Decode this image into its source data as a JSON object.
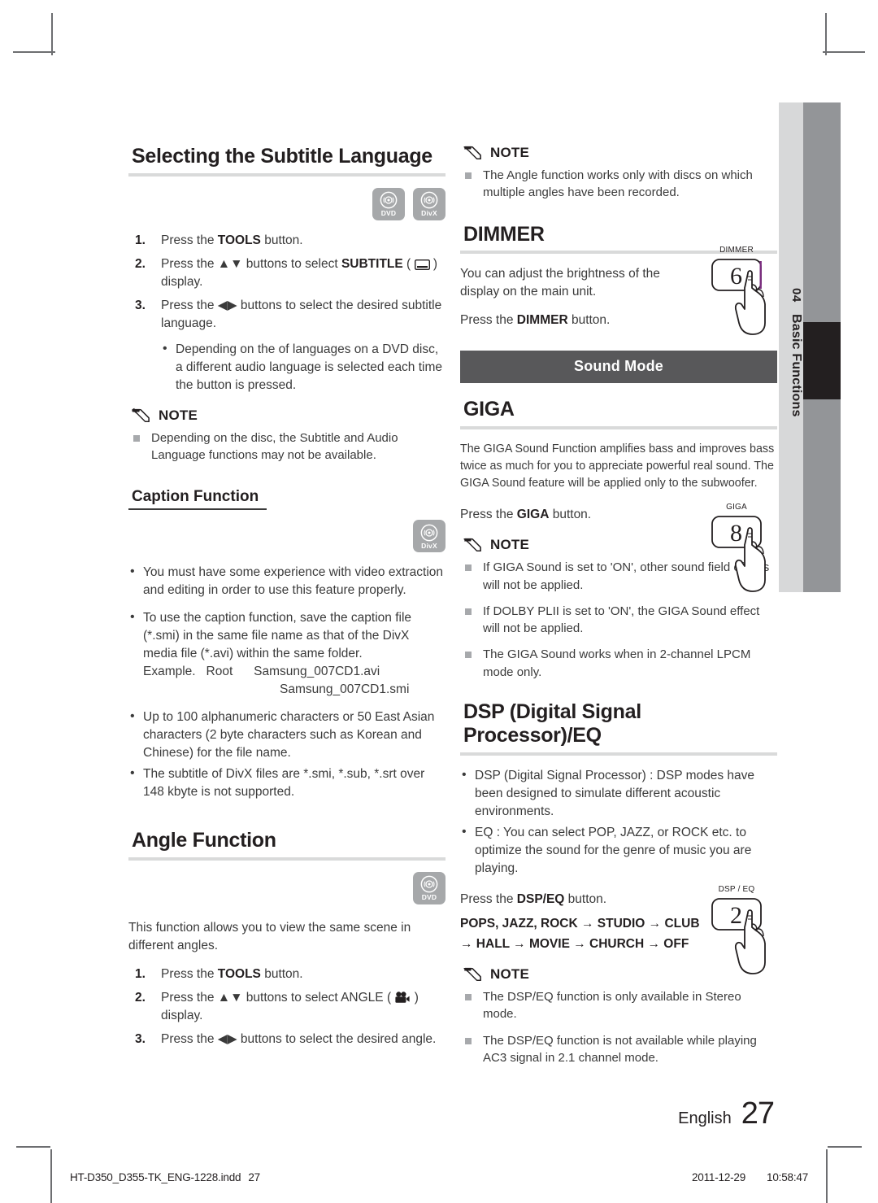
{
  "document": {
    "chapter_number": "04",
    "chapter_name": "Basic Functions",
    "page_language": "English",
    "page_number": "27",
    "imprint_file": "HT-D350_D355-TK_ENG-1228.indd",
    "imprint_page": "27",
    "imprint_date": "2011-12-29",
    "imprint_time": "10:58:47"
  },
  "left_column": {
    "subtitle_section": {
      "title": "Selecting the Subtitle Language",
      "badges": [
        {
          "label": "DVD",
          "icon": "disc-icon"
        },
        {
          "label": "DivX",
          "icon": "disc-icon"
        }
      ],
      "steps": [
        {
          "num": "1.",
          "pre": "Press the ",
          "bold": "TOOLS",
          "post": " button."
        },
        {
          "num": "2.",
          "pre": "Press the ▲▼ buttons to select ",
          "bold": "SUBTITLE",
          "post": " (  ) display."
        },
        {
          "num": "3.",
          "pre": "Press the ◀▶ buttons to select the desired subtitle language.",
          "bold": "",
          "post": ""
        }
      ],
      "sub_bullets": [
        "Depending on the of languages on a DVD disc, a different audio language is selected each time the button is pressed."
      ],
      "note_label": "NOTE",
      "notes": [
        "Depending on the disc, the Subtitle and Audio Language functions may not be available."
      ]
    },
    "caption_section": {
      "title": "Caption Function",
      "badges": [
        {
          "label": "DivX",
          "icon": "disc-icon"
        }
      ],
      "bullets": [
        "You must have some experience with video extraction and editing in order to use this feature properly.",
        "To use the caption function, save the caption file (*.smi) in the same file name as that of the DivX media file (*.avi) within the same folder.",
        "Up to 100 alphanumeric characters or 50 East Asian characters (2 byte characters such as Korean and Chinese) for the file name.",
        "The subtitle of DivX files are *.smi, *.sub, *.srt over 148 kbyte is not supported."
      ],
      "example_label": "Example.",
      "example_root": "Root",
      "example_files": [
        "Samsung_007CD1.avi",
        "Samsung_007CD1.smi"
      ]
    },
    "angle_section": {
      "title": "Angle Function",
      "badges": [
        {
          "label": "DVD",
          "icon": "disc-icon"
        }
      ],
      "intro": "This function allows you to view the same scene in different angles.",
      "steps": [
        {
          "num": "1.",
          "pre": "Press the ",
          "bold": "TOOLS",
          "post": " button."
        },
        {
          "num": "2.",
          "pre": "Press the ▲▼ buttons to select ANGLE (  ) display.",
          "bold": "",
          "post": ""
        },
        {
          "num": "3.",
          "pre": "Press the ◀▶ buttons to select the desired angle.",
          "bold": "",
          "post": ""
        }
      ]
    }
  },
  "right_column": {
    "angle_note": {
      "note_label": "NOTE",
      "notes": [
        "The Angle function works only with discs on which multiple angles have been recorded."
      ]
    },
    "dimmer_section": {
      "title": "DIMMER",
      "body": "You can adjust the brightness of the display on the main unit.",
      "press_pre": "Press the ",
      "press_bold": "DIMMER",
      "press_post": " button.",
      "button": {
        "caption": "DIMMER",
        "value": "6"
      }
    },
    "sound_mode_band": "Sound Mode",
    "giga_section": {
      "title": "GIGA",
      "body": "The GIGA Sound Function amplifies bass and improves bass twice as much for you to appreciate powerful real sound. The GIGA Sound feature will be applied only to the subwoofer.",
      "press_pre": "Press the ",
      "press_bold": "GIGA",
      "press_post": " button.",
      "button": {
        "caption": "GIGA",
        "value": "8"
      },
      "note_label": "NOTE",
      "notes": [
        "If GIGA Sound is set to 'ON', other sound field effects will not be applied.",
        "If DOLBY PLII is set to 'ON', the GIGA Sound effect will not be applied.",
        "The GIGA Sound works when in 2-channel LPCM mode only."
      ]
    },
    "dsp_section": {
      "title": "DSP (Digital Signal Processor)/EQ",
      "bullets": [
        "DSP (Digital Signal Processor) : DSP modes have been designed to simulate different acoustic environments.",
        "EQ : You can select POP, JAZZ, or ROCK etc. to optimize the sound for the genre of music you are playing."
      ],
      "press_pre": "Press the ",
      "press_bold": "DSP/EQ",
      "press_post": " button.",
      "button": {
        "caption": "DSP / EQ",
        "value": "2"
      },
      "sequence_line1": "POPS, JAZZ, ROCK → STUDIO → CLUB",
      "sequence_line2": "→ HALL → MOVIE → CHURCH → OFF",
      "note_label": "NOTE",
      "notes": [
        "The DSP/EQ function is only available in Stereo mode.",
        "The DSP/EQ function is not available while playing AC3 signal in 2.1 channel mode."
      ]
    }
  },
  "colors": {
    "rule": "#d9dada",
    "band": "#58585a",
    "badge": "#a6a8aa",
    "tab_light": "#d7d8d9",
    "tab_dark": "#939598",
    "tab_black": "#231f20"
  }
}
